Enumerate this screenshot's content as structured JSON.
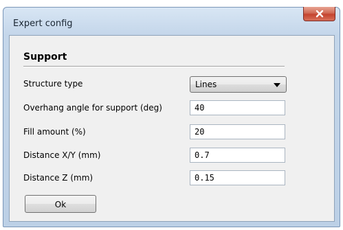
{
  "window": {
    "title": "Expert config",
    "close_icon": "close-icon"
  },
  "section": {
    "title": "Support"
  },
  "fields": {
    "structure_type": {
      "label": "Structure type",
      "value": "Lines"
    },
    "overhang_angle": {
      "label": "Overhang angle for support (deg)",
      "value": "40"
    },
    "fill_amount": {
      "label": "Fill amount (%)",
      "value": "20"
    },
    "distance_xy": {
      "label": "Distance X/Y (mm)",
      "value": "0.7"
    },
    "distance_z": {
      "label": "Distance Z (mm)",
      "value": "0.15"
    }
  },
  "buttons": {
    "ok_label": "Ok"
  },
  "colors": {
    "close_button": "#c5432e",
    "window_frame": "#bcd0e6",
    "client_background": "#f0f0f0"
  }
}
